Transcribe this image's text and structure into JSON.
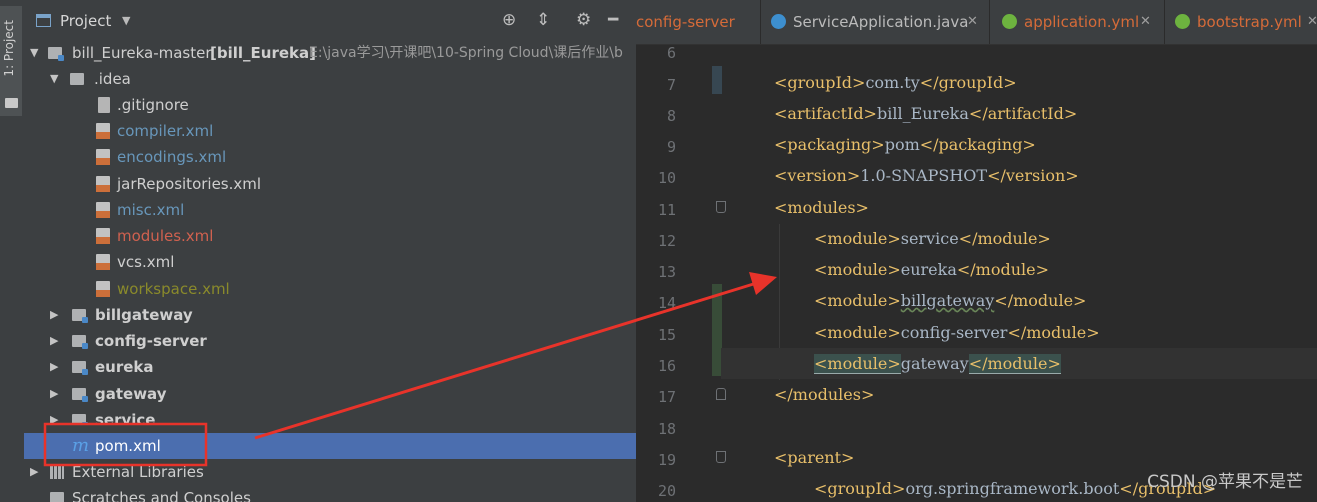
{
  "side_tab": {
    "label": "1: Project"
  },
  "project_panel": {
    "title": "Project",
    "tree": [
      {
        "label": "bill_Eureka-master",
        "suffix": "[bill_Eureka]",
        "path": "E:\\java学习\\开课吧\\10-Spring Cloud\\课后作业\\b"
      },
      {
        "label": ".idea"
      },
      {
        "label": ".gitignore"
      },
      {
        "label": "compiler.xml"
      },
      {
        "label": "encodings.xml"
      },
      {
        "label": "jarRepositories.xml"
      },
      {
        "label": "misc.xml"
      },
      {
        "label": "modules.xml"
      },
      {
        "label": "vcs.xml"
      },
      {
        "label": "workspace.xml"
      },
      {
        "label": "billgateway"
      },
      {
        "label": "config-server"
      },
      {
        "label": "eureka"
      },
      {
        "label": "gateway"
      },
      {
        "label": "service"
      },
      {
        "label": "pom.xml"
      },
      {
        "label": "External Libraries"
      },
      {
        "label": "Scratches and Consoles"
      }
    ]
  },
  "editor": {
    "tabs": [
      {
        "label": "config-server"
      },
      {
        "label": "ServiceApplication.java"
      },
      {
        "label": "application.yml"
      },
      {
        "label": "bootstrap.yml"
      }
    ],
    "lines": [
      {
        "num": "6"
      },
      {
        "num": "7",
        "open": "<groupId>",
        "text": "com.ty",
        "close": "</groupId>"
      },
      {
        "num": "8",
        "open": "<artifactId>",
        "text": "bill_Eureka",
        "close": "</artifactId>"
      },
      {
        "num": "9",
        "open": "<packaging>",
        "text": "pom",
        "close": "</packaging>"
      },
      {
        "num": "10",
        "open": "<version>",
        "text": "1.0-SNAPSHOT",
        "close": "</version>"
      },
      {
        "num": "11",
        "open": "<modules>"
      },
      {
        "num": "12",
        "open": "<module>",
        "text": "service",
        "close": "</module>"
      },
      {
        "num": "13",
        "open": "<module>",
        "text": "eureka",
        "close": "</module>"
      },
      {
        "num": "14",
        "open": "<module>",
        "text": "billgateway",
        "close": "</module>"
      },
      {
        "num": "15",
        "open": "<module>",
        "text": "config-server",
        "close": "</module>"
      },
      {
        "num": "16",
        "open": "<module>",
        "text": "gateway",
        "close": "</module>"
      },
      {
        "num": "17",
        "open": "</modules>"
      },
      {
        "num": "18"
      },
      {
        "num": "19",
        "open": "<parent>"
      },
      {
        "num": "20",
        "open": "<groupId>",
        "text": "org.springframework.boot",
        "close": "</groupId>"
      }
    ]
  },
  "watermark": "CSDN @苹果不是芒",
  "colors": {
    "annotation": "#e8332a",
    "selection": "#4b6eaf",
    "tag": "#e8bf6a",
    "text": "#a9b7c6"
  }
}
